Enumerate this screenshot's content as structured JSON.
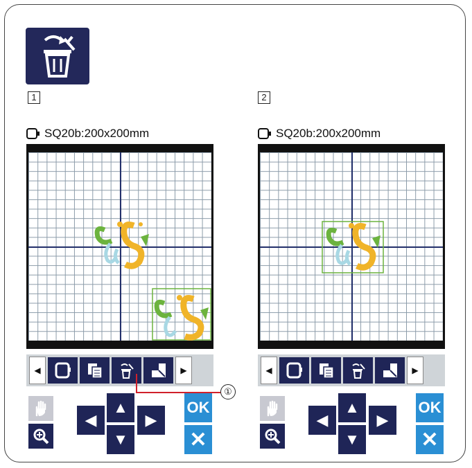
{
  "header_icon": "delete-icon",
  "steps": [
    "1",
    "2"
  ],
  "panels": [
    {
      "title": "SQ20b:200x200mm",
      "toolbar": {
        "left_arrow": "◀",
        "right_arrow": "▶",
        "buttons": [
          "hoop-select-icon",
          "copy-icon",
          "delete-icon",
          "resize-icon"
        ]
      },
      "controls": {
        "hand": "hand-icon",
        "zoom": "zoom-in-icon",
        "left": "◀",
        "up": "▲",
        "down": "▼",
        "right": "▶",
        "ok": "OK",
        "cancel": "✕"
      }
    },
    {
      "title": "SQ20b:200x200mm",
      "toolbar": {
        "left_arrow": "◀",
        "right_arrow": "▶",
        "buttons": [
          "hoop-select-icon",
          "copy-icon",
          "delete-icon",
          "resize-icon"
        ]
      },
      "controls": {
        "hand": "hand-icon",
        "zoom": "zoom-in-icon",
        "left": "◀",
        "up": "▲",
        "down": "▼",
        "right": "▶",
        "ok": "OK",
        "cancel": "✕"
      }
    }
  ],
  "callout": "①",
  "colors": {
    "button_bg": "#1f2557",
    "accent_blue": "#2a8fd4",
    "design_yellow": "#f0b429",
    "design_green": "#6cb33e",
    "design_lightblue": "#a8d8e4",
    "callout_red": "#d0202a"
  }
}
